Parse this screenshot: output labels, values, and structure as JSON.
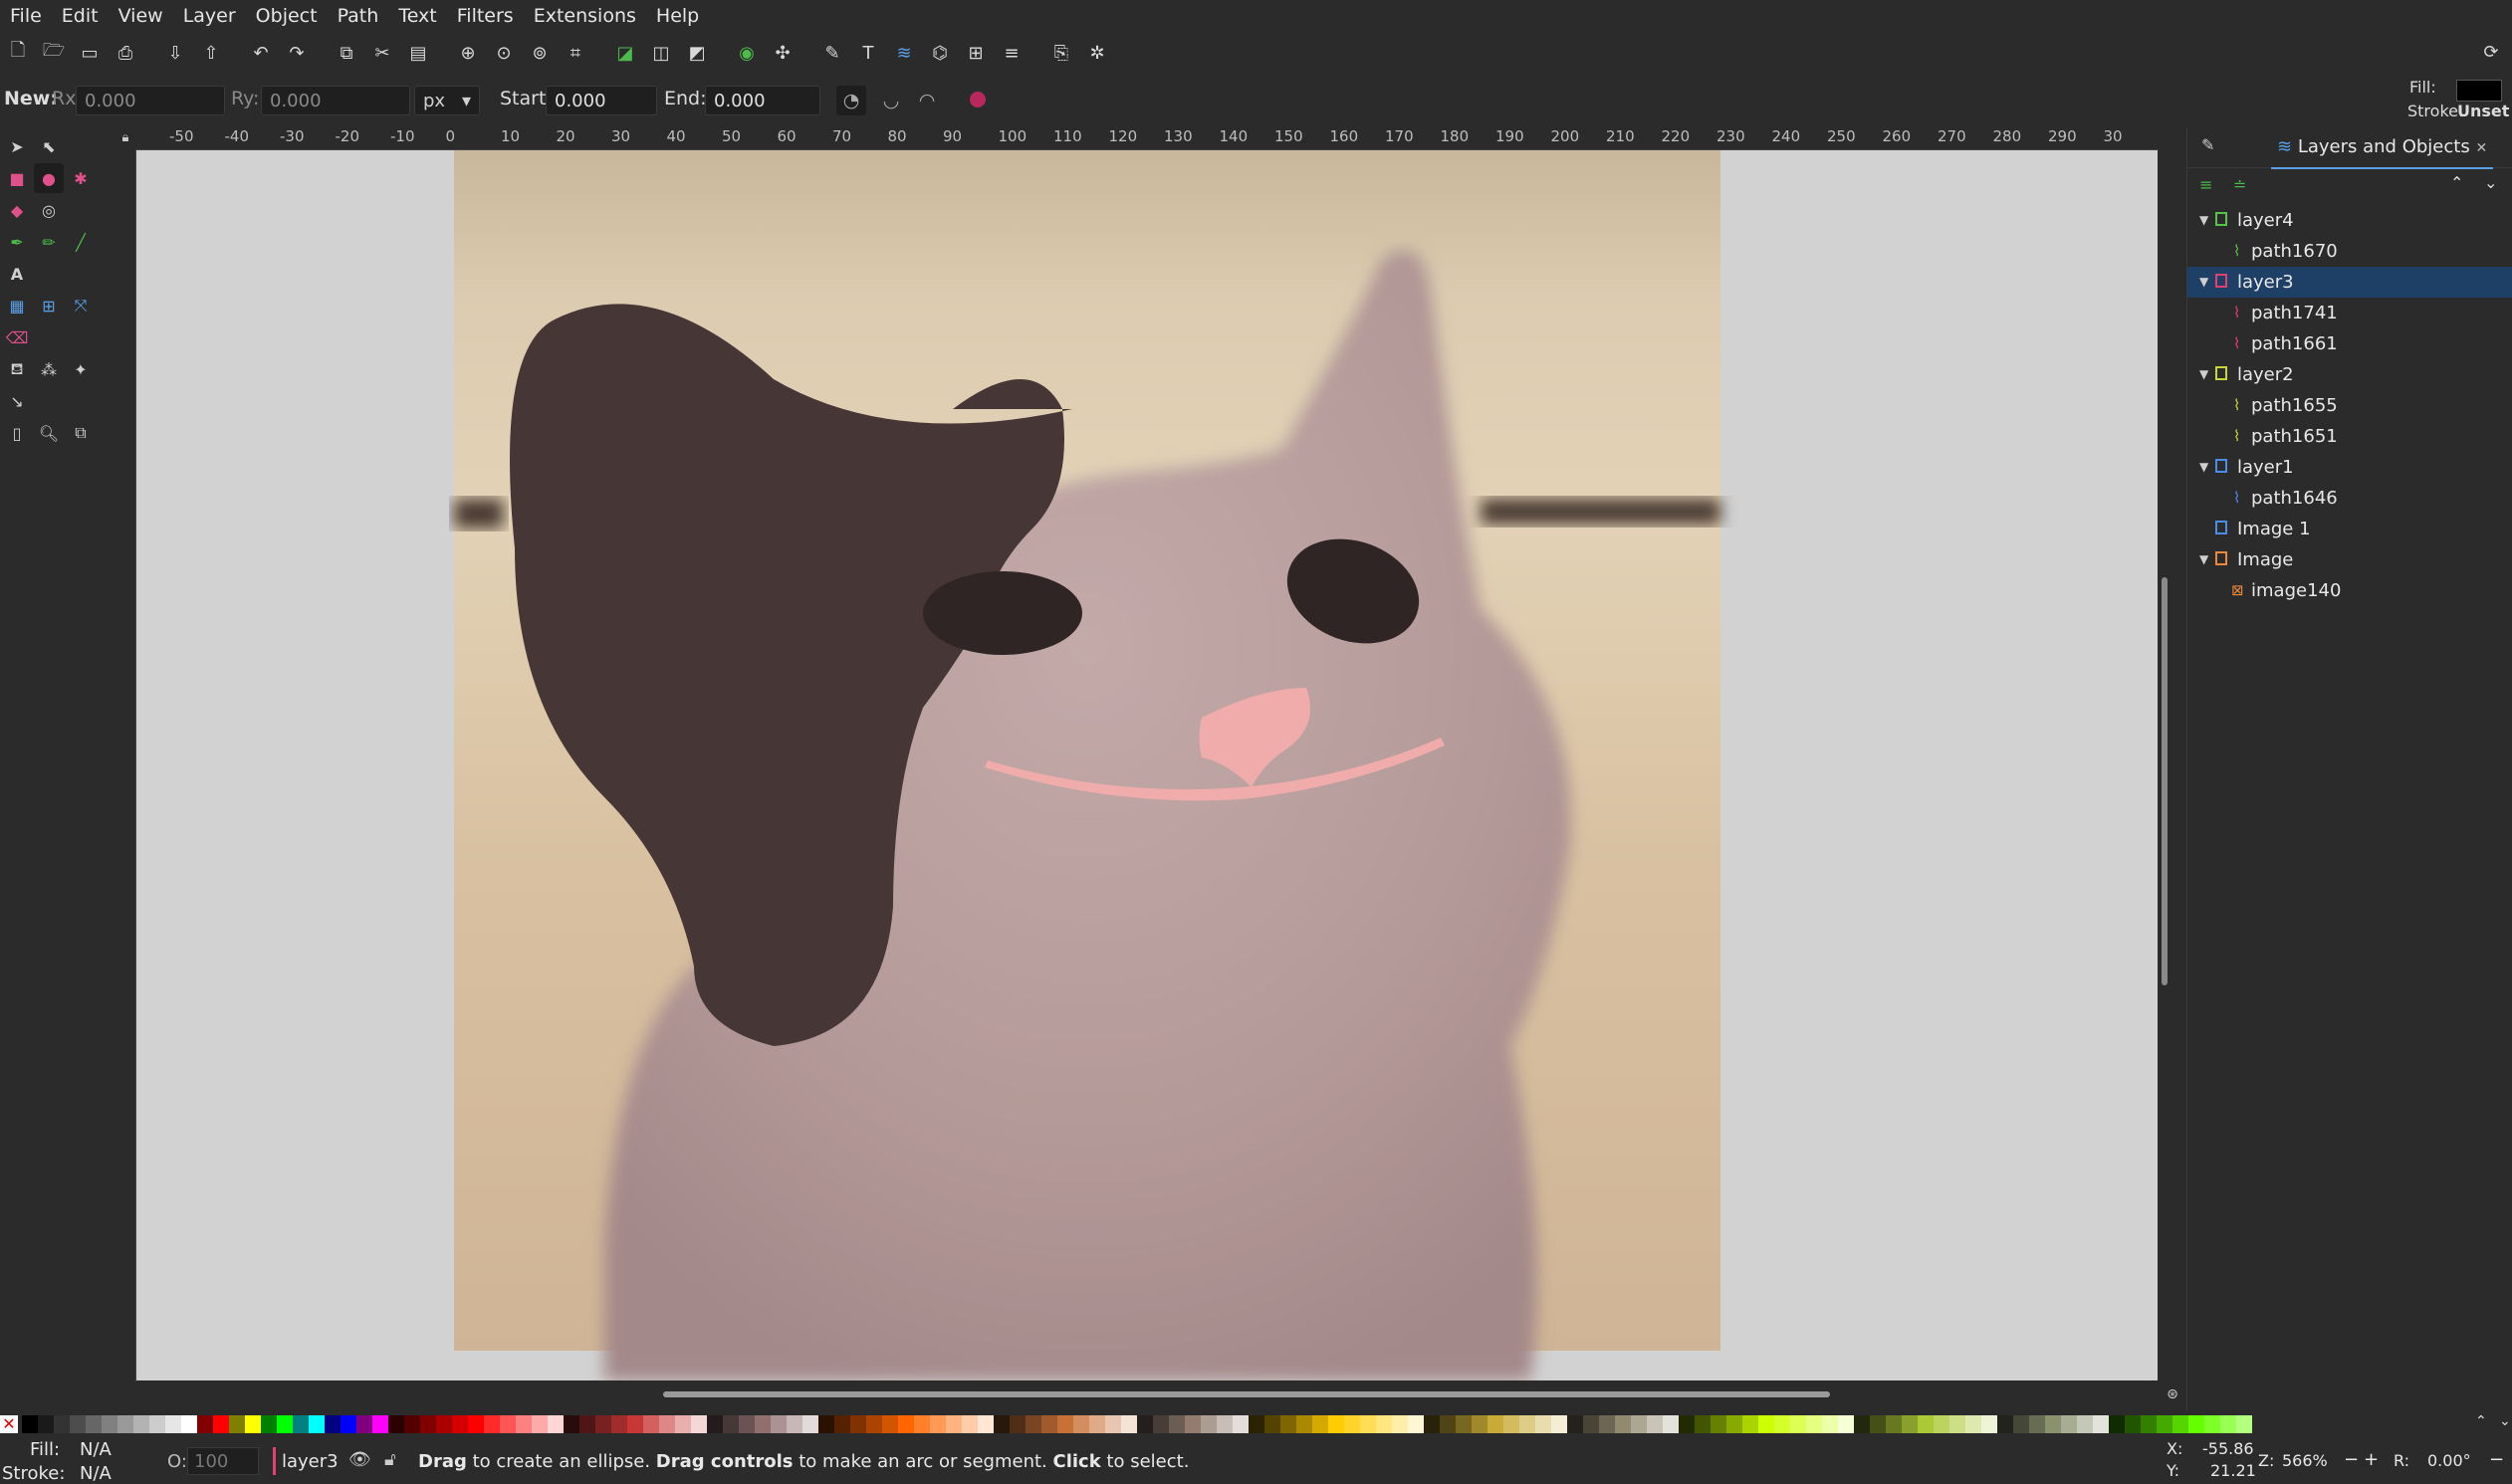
{
  "menu": [
    "File",
    "Edit",
    "View",
    "Layer",
    "Object",
    "Path",
    "Text",
    "Filters",
    "Extensions",
    "Help"
  ],
  "controls": {
    "new_label": "New:",
    "rx_label": "Rx:",
    "rx_value": "0.000",
    "ry_label": "Ry:",
    "ry_value": "0.000",
    "unit": "px",
    "start_label": "Start:",
    "start_value": "0.000",
    "end_label": "End:",
    "end_value": "0.000",
    "fill_label": "Fill:",
    "stroke_label": "Stroke:",
    "stroke_value": "Unset",
    "fill_color": "#000000"
  },
  "ruler_ticks": [
    "-50",
    "-40",
    "-30",
    "-20",
    "-10",
    "0",
    "10",
    "20",
    "30",
    "40",
    "50",
    "60",
    "70",
    "80",
    "90",
    "100",
    "110",
    "120",
    "130",
    "140",
    "150",
    "160",
    "170",
    "180",
    "190",
    "200",
    "210",
    "220",
    "230",
    "240",
    "250",
    "260",
    "270",
    "280",
    "290",
    "30"
  ],
  "panel": {
    "tab_title": "Layers and Objects",
    "tree": [
      {
        "label": "layer4",
        "kind": "layer",
        "color": "#59c04a",
        "expanded": true,
        "depth": 0
      },
      {
        "label": "path1670",
        "kind": "path",
        "color": "#59c04a",
        "depth": 1
      },
      {
        "label": "layer3",
        "kind": "layer",
        "color": "#e3406e",
        "expanded": true,
        "depth": 0,
        "selected": true
      },
      {
        "label": "path1741",
        "kind": "path",
        "color": "#e3406e",
        "depth": 1
      },
      {
        "label": "path1661",
        "kind": "path",
        "color": "#e3406e",
        "depth": 1
      },
      {
        "label": "layer2",
        "kind": "layer",
        "color": "#c8d43a",
        "expanded": true,
        "depth": 0
      },
      {
        "label": "path1655",
        "kind": "path",
        "color": "#c8d43a",
        "depth": 1
      },
      {
        "label": "path1651",
        "kind": "path",
        "color": "#c8d43a",
        "depth": 1
      },
      {
        "label": "layer1",
        "kind": "layer",
        "color": "#4a8de8",
        "expanded": true,
        "depth": 0
      },
      {
        "label": "path1646",
        "kind": "path",
        "color": "#4a8de8",
        "depth": 1
      },
      {
        "label": "Image 1",
        "kind": "layer",
        "color": "#4a8de8",
        "depth": 0
      },
      {
        "label": "Image",
        "kind": "layer",
        "color": "#ec8a3a",
        "expanded": true,
        "depth": 0
      },
      {
        "label": "image140",
        "kind": "image",
        "color": "#ec8a3a",
        "depth": 1
      }
    ]
  },
  "status": {
    "fill_label": "Fill:",
    "fill_value": "N/A",
    "stroke_label": "Stroke:",
    "stroke_value": "N/A",
    "opacity_label": "O:",
    "opacity_value": "100",
    "layer_name": "layer3",
    "msg_b1": "Drag",
    "msg_t1": " to create an ellipse. ",
    "msg_b2": "Drag controls",
    "msg_t2": " to make an arc or segment. ",
    "msg_b3": "Click",
    "msg_t3": " to select.",
    "x_label": "X:",
    "x_value": "-55.86",
    "y_label": "Y:",
    "y_value": "21.21",
    "zoom_label": "Z:",
    "zoom_value": "566%",
    "rot_label": "R:",
    "rot_value": "0.00°"
  },
  "palette": [
    "#000000",
    "#1a1a1a",
    "#333333",
    "#4d4d4d",
    "#666666",
    "#808080",
    "#999999",
    "#b3b3b3",
    "#cccccc",
    "#e6e6e6",
    "#ffffff",
    "#800000",
    "#ff0000",
    "#808000",
    "#ffff00",
    "#008000",
    "#00ff00",
    "#008080",
    "#00ffff",
    "#000080",
    "#0000ff",
    "#800080",
    "#ff00ff",
    "#2b0000",
    "#550000",
    "#800000",
    "#aa0000",
    "#d40000",
    "#ff0000",
    "#ff2a2a",
    "#ff5555",
    "#ff8080",
    "#ffaaaa",
    "#ffd5d5",
    "#280b0b",
    "#501616",
    "#782121",
    "#a02c2c",
    "#c83737",
    "#d35f5f",
    "#de8787",
    "#e9afaf",
    "#f4d7d7",
    "#241c1c",
    "#483737",
    "#6c5353",
    "#916f6f",
    "#ac9393",
    "#c8b7b7",
    "#e3dbdb",
    "#2b1100",
    "#552200",
    "#803300",
    "#aa4400",
    "#d45500",
    "#ff6600",
    "#ff7f2a",
    "#ff9955",
    "#ffb380",
    "#ffccaa",
    "#ffe6d5",
    "#28170b",
    "#502d16",
    "#784421",
    "#a05a2c",
    "#c87137",
    "#d38d5f",
    "#deaa87",
    "#e9c6af",
    "#f4e3d7",
    "#241f1c",
    "#483e37",
    "#6c5d53",
    "#917c6f",
    "#ac9d93",
    "#c8beb7",
    "#e3dedb",
    "#2b2200",
    "#554400",
    "#806600",
    "#aa8800",
    "#d4aa00",
    "#ffcc00",
    "#ffd42a",
    "#ffdd55",
    "#ffe680",
    "#ffeeaa",
    "#fff6d5",
    "#28220b",
    "#504416",
    "#786721",
    "#a0892c",
    "#c8ab37",
    "#d3bc5f",
    "#decd87",
    "#e9ddaf",
    "#f4eed7",
    "#24221c",
    "#484537",
    "#6c6753",
    "#918a6f",
    "#aca793",
    "#c8c4b7",
    "#e3e2db",
    "#222b00",
    "#445500",
    "#668000",
    "#88aa00",
    "#aad400",
    "#ccff00",
    "#d4ff2a",
    "#ddff55",
    "#e5ff80",
    "#eeffaa",
    "#f6ffd5",
    "#22280b",
    "#445016",
    "#677821",
    "#89a02c",
    "#abc837",
    "#bcd35f",
    "#cdde87",
    "#dde9af",
    "#eef4d7",
    "#22241c",
    "#454837",
    "#676c53",
    "#8a916f",
    "#a7ac93",
    "#c4c8b7",
    "#e2e3db",
    "#112b00",
    "#225500",
    "#338000",
    "#44aa00",
    "#55d400",
    "#66ff00",
    "#7fff2a",
    "#99ff55",
    "#b3ff80"
  ]
}
